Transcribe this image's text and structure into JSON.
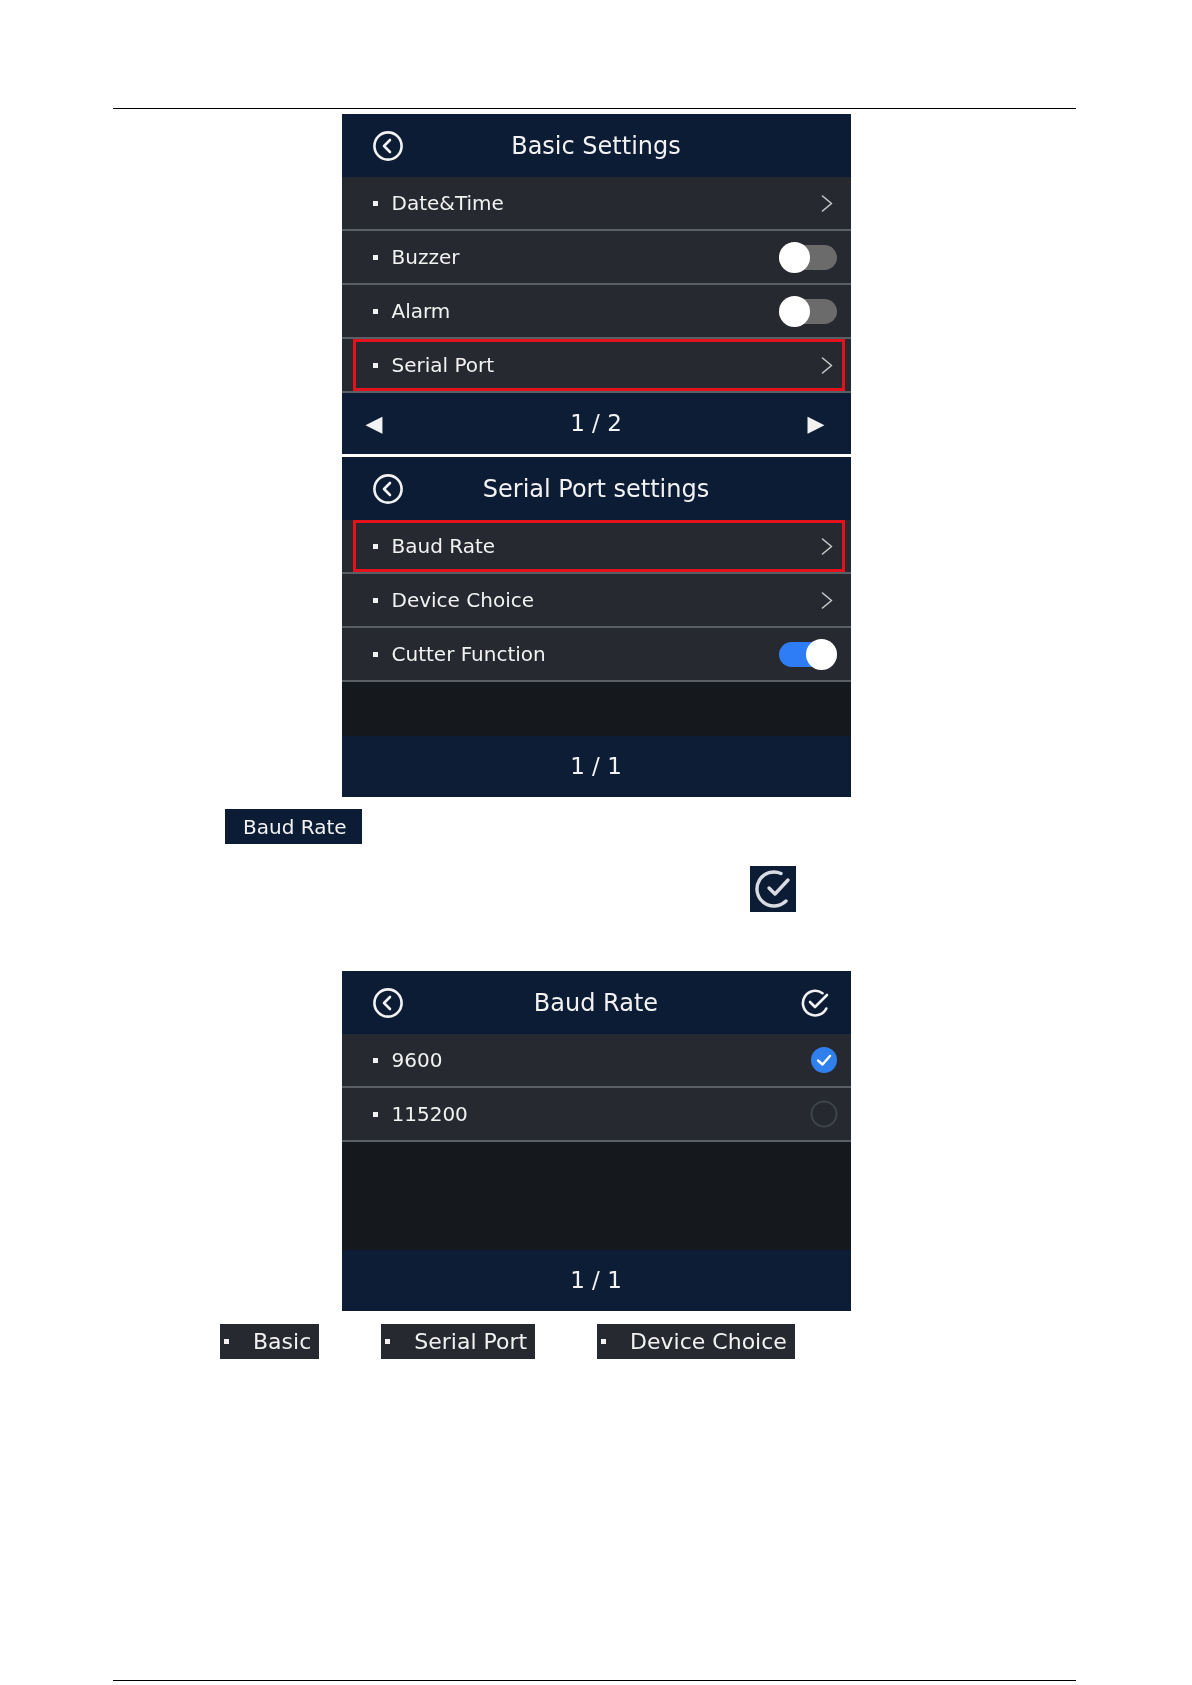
{
  "blocks": [
    {
      "kind": "screen",
      "title": "Basic Settings",
      "confirm_button": false,
      "rows": [
        {
          "kind": "link",
          "label": "Date&Time",
          "highlighted": false
        },
        {
          "kind": "toggle",
          "label": "Buzzer",
          "on": false,
          "highlighted": false
        },
        {
          "kind": "toggle",
          "label": "Alarm",
          "on": false,
          "highlighted": false
        },
        {
          "kind": "link",
          "label": "Serial Port",
          "highlighted": true
        }
      ],
      "footer": {
        "prev": "◀",
        "page": "1 / 2",
        "next": "▶"
      }
    },
    {
      "kind": "screen",
      "title": "Serial Port settings",
      "confirm_button": false,
      "rows": [
        {
          "kind": "link",
          "label": "Baud Rate",
          "highlighted": true
        },
        {
          "kind": "link",
          "label": "Device Choice",
          "highlighted": false
        },
        {
          "kind": "toggle",
          "label": "Cutter Function",
          "on": true,
          "highlighted": false
        }
      ],
      "footer": {
        "page": "1 / 1"
      }
    },
    {
      "kind": "title_chip",
      "text": "Baud Rate"
    },
    {
      "kind": "screen",
      "title": "Baud Rate",
      "confirm_button": true,
      "rows": [
        {
          "kind": "radio",
          "label": "9600",
          "selected": true,
          "highlighted": false
        },
        {
          "kind": "radio",
          "label": "115200",
          "selected": false,
          "highlighted": false
        }
      ],
      "footer": {
        "page": "1 / 1"
      }
    },
    {
      "kind": "menu_chips",
      "items": [
        {
          "label": "Basic"
        },
        {
          "label": "Serial Port"
        },
        {
          "label": "Device Choice"
        }
      ]
    }
  ]
}
